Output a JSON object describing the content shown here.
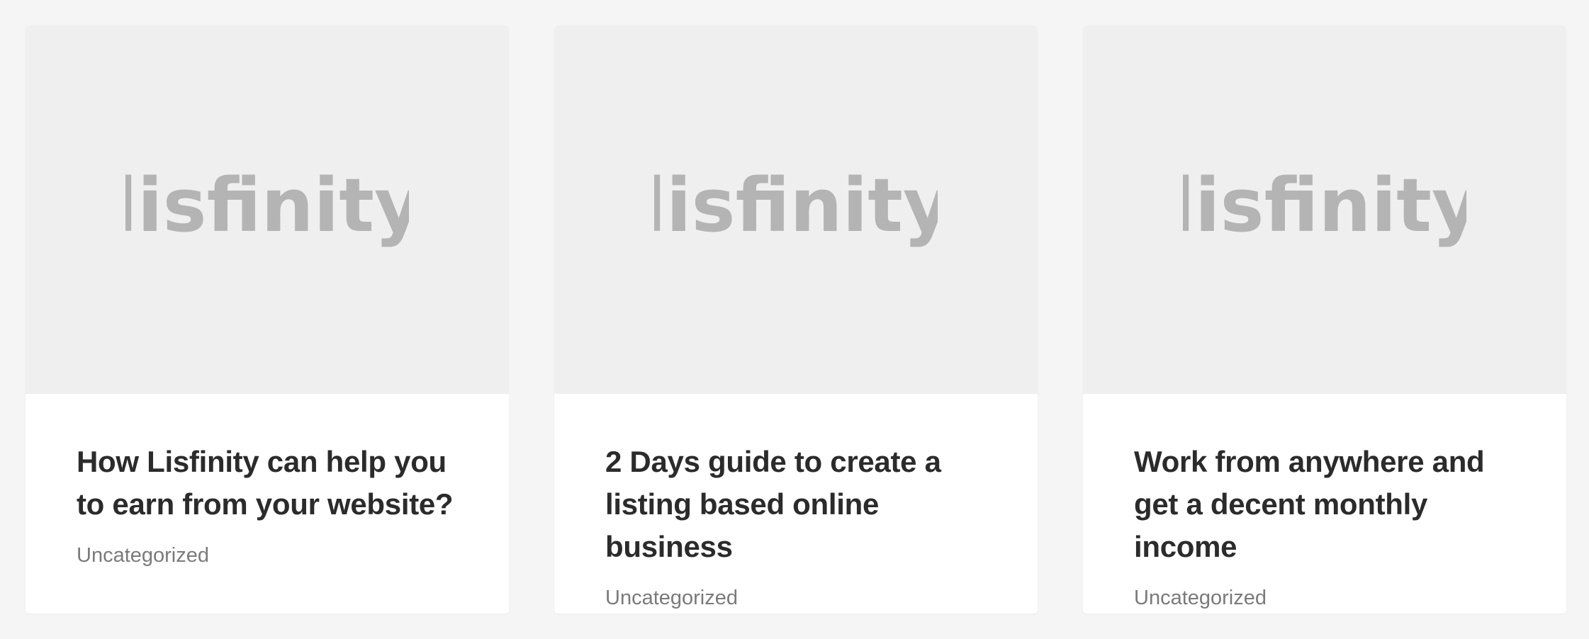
{
  "posts": [
    {
      "logo_text": "lisfinity",
      "title": "How Lisfinity can help you to earn from your website?",
      "category": "Uncategorized"
    },
    {
      "logo_text": "lisfinity",
      "title": "2 Days guide to create a listing based online business",
      "category": "Uncategorized"
    },
    {
      "logo_text": "lisfinity",
      "title": "Work from anywhere and get a decent monthly income",
      "category": "Uncategorized"
    }
  ],
  "colors": {
    "page_background": "#f5f5f5",
    "card_background": "#ffffff",
    "thumbnail_background": "#efefef",
    "logo": "#b4b4b4",
    "title": "#2b2b2b",
    "category": "#7a7a7a"
  }
}
